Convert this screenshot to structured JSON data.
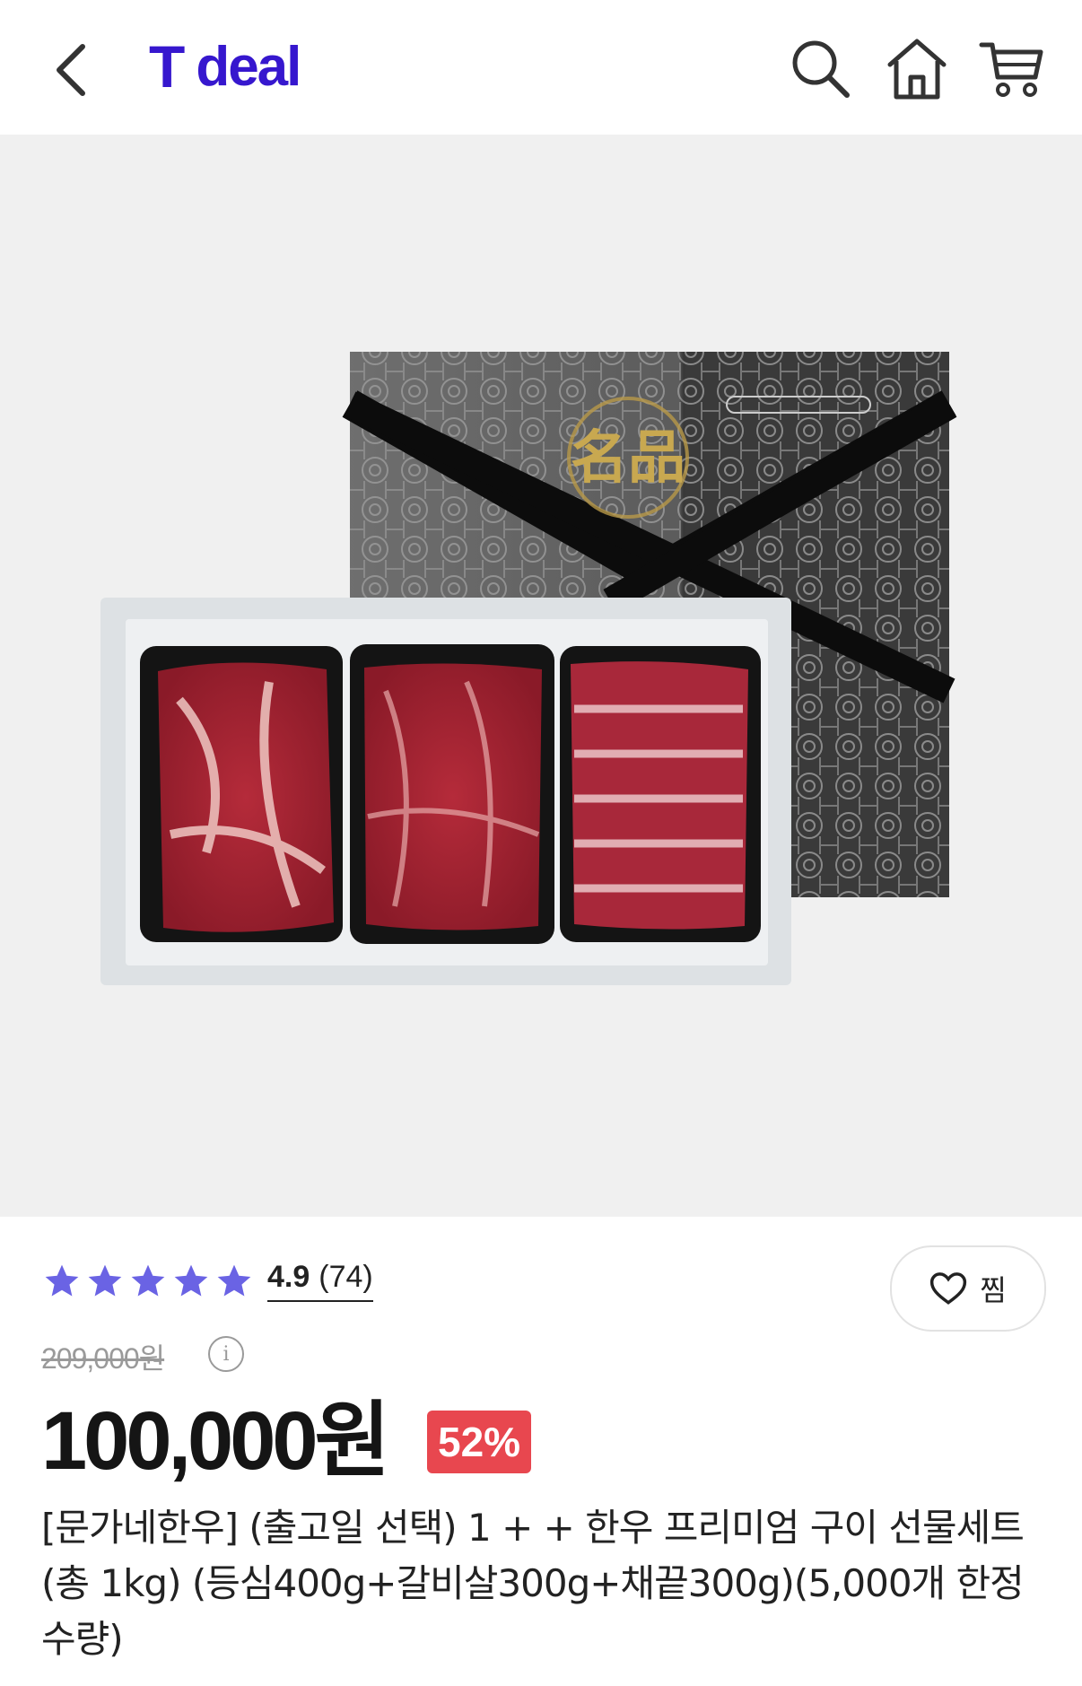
{
  "header": {
    "logo_t": "T",
    "logo_text": "deal",
    "brand_color": "#3617ce",
    "icons": [
      "back-chevron-icon",
      "search-icon",
      "home-icon",
      "cart-icon"
    ]
  },
  "product_image": {
    "seal_text": "名品"
  },
  "product": {
    "rating_score": "4.9",
    "review_count": "(74)",
    "stars": 5,
    "wish_label": "찜",
    "original_price": "209,000원",
    "sale_price": "100,000원",
    "discount": "52%",
    "title": "[문가네한우] (출고일 선택) 1 + + 한우 프리미엄 구이 선물세트(총 1kg) (등심400g+갈비살300g+채끝300g)(5,000개 한정 수량)",
    "star_color": "#6a63e4",
    "discount_color": "#e8474f"
  }
}
